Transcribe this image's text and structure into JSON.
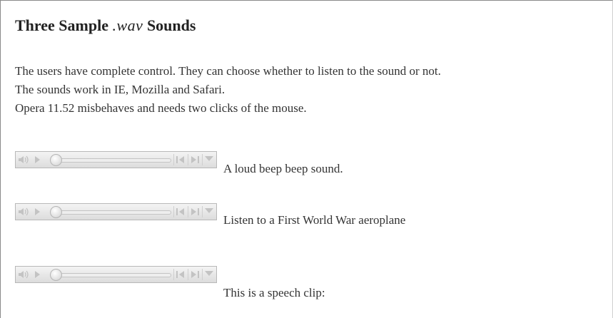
{
  "heading": {
    "prefix": "Three Sample ",
    "extension": ".wav",
    "suffix": " Sounds"
  },
  "intro": {
    "line1": "The users have complete control. They can choose whether to listen to the sound or not.",
    "line2": "The sounds work in IE, Mozilla and Safari.",
    "line3": "Opera 11.52 misbehaves and needs two clicks of the mouse."
  },
  "players": [
    {
      "caption": "A loud beep beep sound.",
      "progress": 0
    },
    {
      "caption": "Listen to a First World War aeroplane",
      "progress": 0
    },
    {
      "caption": "This is a speech clip:",
      "progress": 0
    }
  ],
  "controls": {
    "icons": [
      "volume-icon",
      "play-icon",
      "seek-slider",
      "rewind-icon",
      "fast-forward-icon",
      "menu-dropdown-icon"
    ],
    "icon_color": "#c3c3c3"
  }
}
